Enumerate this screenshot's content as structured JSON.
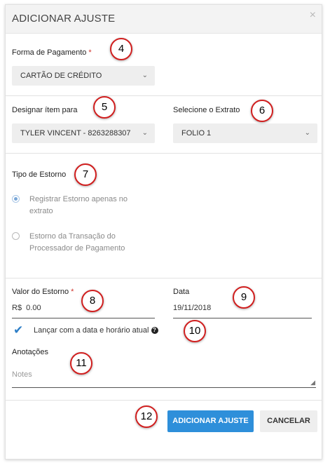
{
  "dialog": {
    "title": "ADICIONAR AJUSTE",
    "close_icon": "×"
  },
  "payment": {
    "label": "Forma de Pagamento",
    "required_mark": "*",
    "value": "CARTÃO DE CRÉDITO"
  },
  "assign": {
    "label": "Designar ítem para",
    "value": "TYLER VINCENT - 8263288307"
  },
  "statement": {
    "label": "Selecione o Extrato",
    "value": "FOLIO 1"
  },
  "chevron": "⌄",
  "refund_type": {
    "label": "Tipo de Estorno",
    "options": [
      {
        "label": "Registrar Estorno apenas no extrato",
        "selected": true
      },
      {
        "label": "Estorno da Transação do Processador de Pagamento",
        "selected": false
      }
    ]
  },
  "amount": {
    "label": "Valor do Estorno",
    "required_mark": "*",
    "value": "R$  0.00"
  },
  "date": {
    "label": "Data",
    "value": "19/11/2018"
  },
  "post_now": {
    "check": "✔",
    "label": "Lançar com a data e horário atual",
    "help": "?"
  },
  "notes": {
    "label": "Anotações",
    "placeholder": "Notes",
    "resize_grip": "◢"
  },
  "buttons": {
    "add": "ADICIONAR AJUSTE",
    "cancel": "CANCELAR"
  },
  "badges": [
    "4",
    "5",
    "6",
    "7",
    "8",
    "9",
    "10",
    "11",
    "12"
  ],
  "colors": {
    "primary": "#2e8fda",
    "badge_border": "#d11f1f",
    "required": "#d0342c",
    "check": "#2e7fc7"
  }
}
